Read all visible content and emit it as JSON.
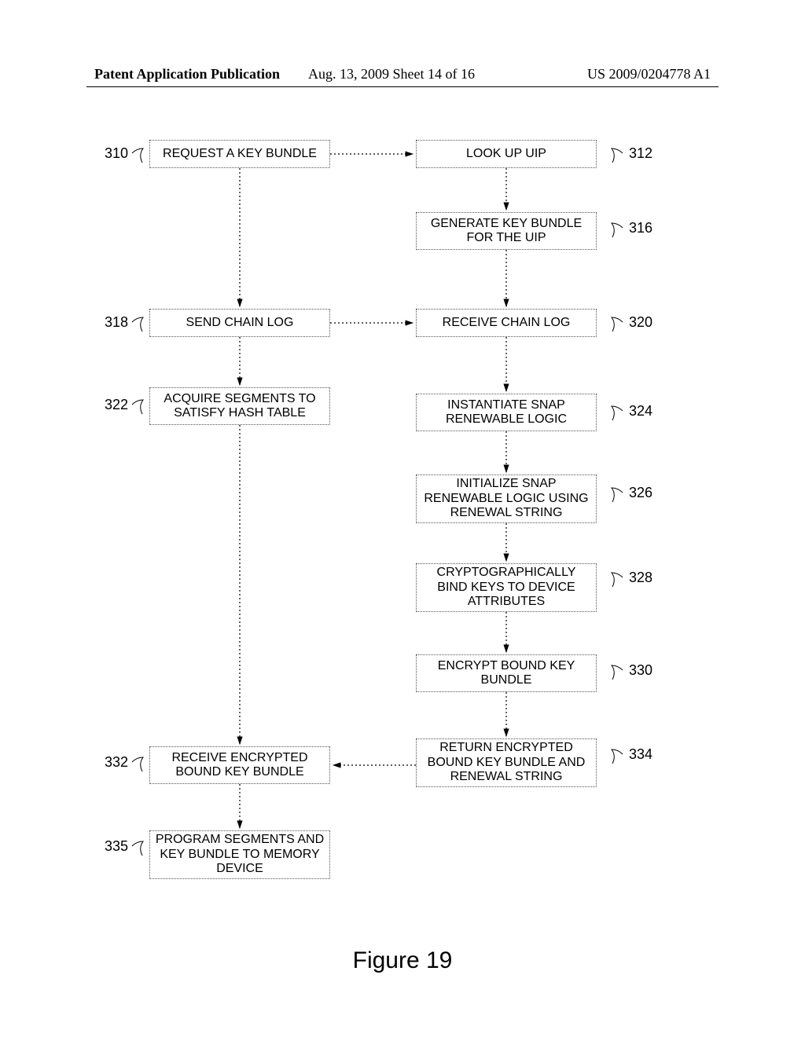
{
  "header": {
    "left": "Patent Application Publication",
    "center": "Aug. 13, 2009  Sheet 14 of 16",
    "right": "US 2009/0204778 A1"
  },
  "figure_caption": "Figure 19",
  "boxes": {
    "b310": {
      "ref": "310",
      "text": "REQUEST A KEY BUNDLE"
    },
    "b312": {
      "ref": "312",
      "text": "LOOK UP UIP"
    },
    "b316": {
      "ref": "316",
      "text": "GENERATE KEY BUNDLE FOR THE UIP"
    },
    "b318": {
      "ref": "318",
      "text": "SEND CHAIN LOG"
    },
    "b320": {
      "ref": "320",
      "text": "RECEIVE CHAIN LOG"
    },
    "b322": {
      "ref": "322",
      "text": "ACQUIRE SEGMENTS TO SATISFY HASH TABLE"
    },
    "b324": {
      "ref": "324",
      "text": "INSTANTIATE SNAP RENEWABLE LOGIC"
    },
    "b326": {
      "ref": "326",
      "text": "INITIALIZE SNAP RENEWABLE LOGIC USING RENEWAL STRING"
    },
    "b328": {
      "ref": "328",
      "text": "CRYPTOGRAPHICALLY BIND KEYS TO DEVICE ATTRIBUTES"
    },
    "b330": {
      "ref": "330",
      "text": "ENCRYPT BOUND KEY BUNDLE"
    },
    "b332": {
      "ref": "332",
      "text": "RECEIVE ENCRYPTED BOUND KEY BUNDLE"
    },
    "b334": {
      "ref": "334",
      "text": "RETURN ENCRYPTED BOUND KEY BUNDLE AND RENEWAL STRING"
    },
    "b335": {
      "ref": "335",
      "text": "PROGRAM SEGMENTS AND KEY BUNDLE TO MEMORY DEVICE"
    }
  }
}
